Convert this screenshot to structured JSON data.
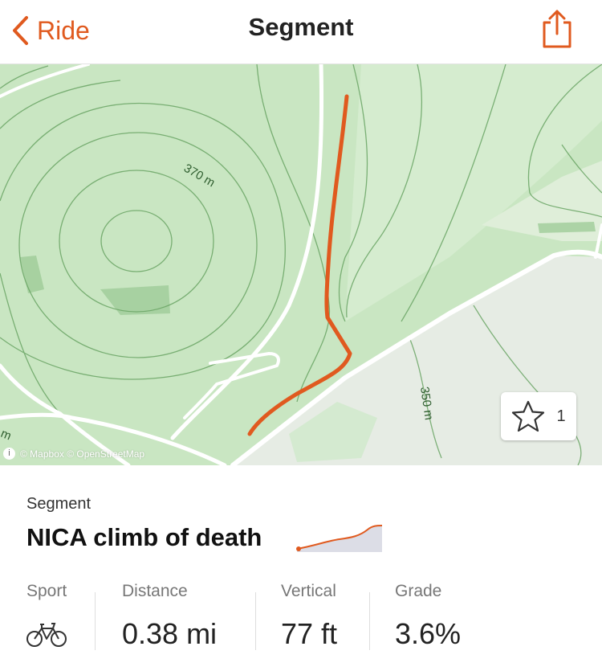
{
  "nav": {
    "back_label": "Ride",
    "title": "Segment"
  },
  "map": {
    "contour_labels": [
      "370 m",
      "350 m",
      "m"
    ],
    "attribution": "© Mapbox © OpenStreetMap",
    "info_icon": "i",
    "route_color": "#e05a1f",
    "star_count": "1"
  },
  "segment": {
    "label": "Segment",
    "name": "NICA climb of death"
  },
  "stats": {
    "sport_label": "Sport",
    "sport_icon": "bike-icon",
    "distance_label": "Distance",
    "distance_value": "0.38 mi",
    "vertical_label": "Vertical",
    "vertical_value": "77 ft",
    "grade_label": "Grade",
    "grade_value": "3.6%"
  },
  "colors": {
    "accent": "#e05a1f",
    "map_green": "#c9e6c2",
    "map_gray": "#e8ece6"
  }
}
